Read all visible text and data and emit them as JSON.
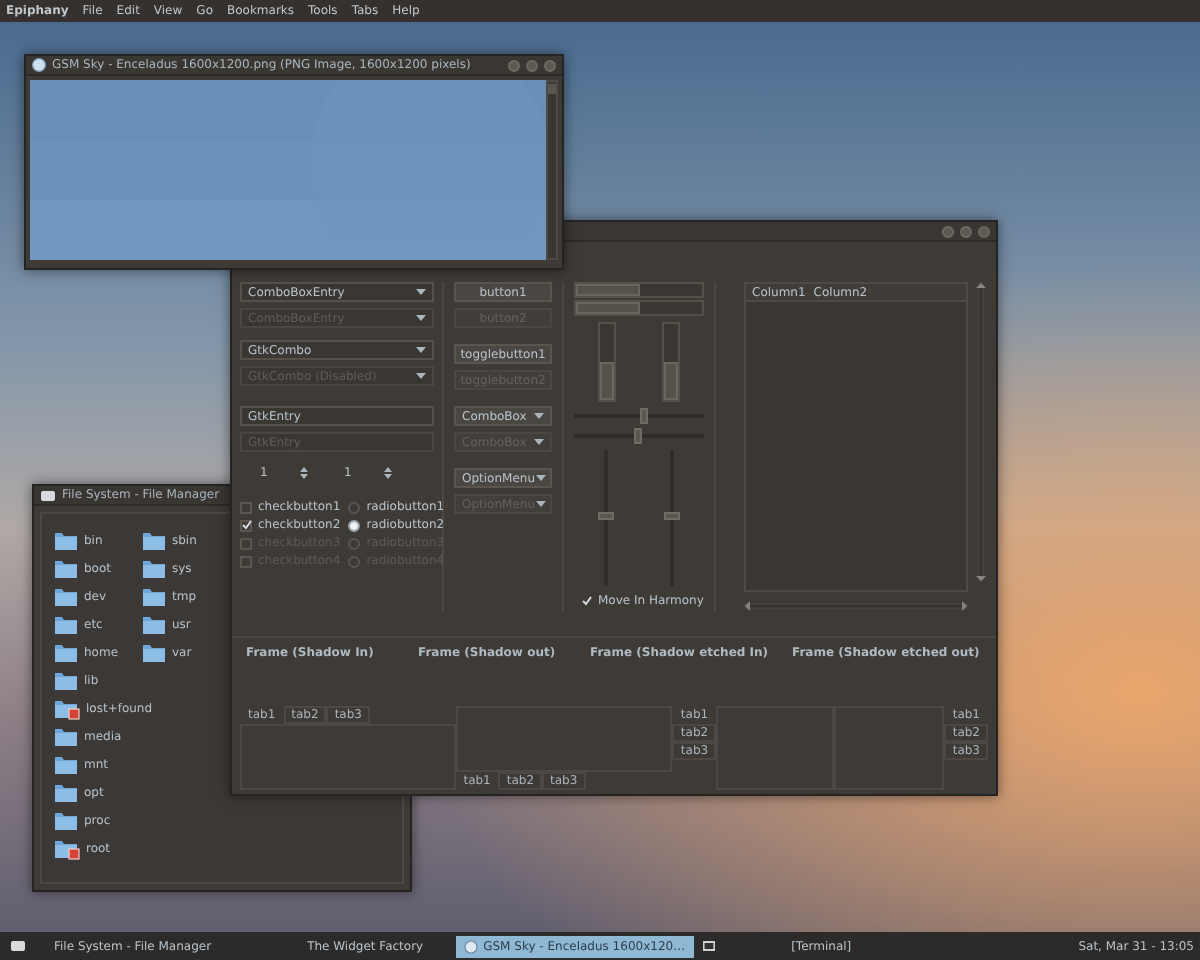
{
  "menubar": {
    "app": "Epiphany",
    "items": [
      "File",
      "Edit",
      "View",
      "Go",
      "Bookmarks",
      "Tools",
      "Tabs",
      "Help"
    ]
  },
  "browser_window": {
    "title": "GSM Sky - Enceladus 1600x1200.png (PNG Image, 1600x1200 pixels)"
  },
  "widget_factory": {
    "fields": [
      {
        "kind": "combo",
        "text": "ComboBoxEntry",
        "disabled": false
      },
      {
        "kind": "combo",
        "text": "ComboBoxEntry",
        "disabled": true
      },
      {
        "kind": "combo",
        "text": "GtkCombo",
        "disabled": false
      },
      {
        "kind": "combo",
        "text": "GtkCombo (Disabled)",
        "disabled": true
      },
      {
        "kind": "entry",
        "text": "GtkEntry",
        "disabled": false
      },
      {
        "kind": "entry",
        "text": "GtkEntry",
        "disabled": true
      }
    ],
    "spinbuttons": [
      "1",
      "1"
    ],
    "checkbuttons": [
      {
        "label": "checkbutton1",
        "checked": false,
        "disabled": false
      },
      {
        "label": "checkbutton2",
        "checked": true,
        "disabled": false
      },
      {
        "label": "checkbutton3",
        "checked": false,
        "disabled": true
      },
      {
        "label": "checkbutton4",
        "checked": false,
        "disabled": true
      }
    ],
    "radiobuttons": [
      {
        "label": "radiobutton1",
        "selected": false,
        "disabled": false
      },
      {
        "label": "radiobutton2",
        "selected": true,
        "disabled": false
      },
      {
        "label": "radiobutton3",
        "selected": false,
        "disabled": true
      },
      {
        "label": "radiobutton4",
        "selected": false,
        "disabled": true
      }
    ],
    "buttons": [
      {
        "kind": "button",
        "label": "button1",
        "disabled": false
      },
      {
        "kind": "button",
        "label": "button2",
        "disabled": true
      },
      {
        "kind": "button",
        "label": "togglebutton1",
        "disabled": false
      },
      {
        "kind": "button",
        "label": "togglebutton2",
        "disabled": true
      },
      {
        "kind": "combo",
        "label": "ComboBox",
        "disabled": false
      },
      {
        "kind": "combo",
        "label": "ComboBox",
        "disabled": true
      },
      {
        "kind": "combo",
        "label": "OptionMenu",
        "disabled": false
      },
      {
        "kind": "combo",
        "label": "OptionMenu",
        "disabled": true
      }
    ],
    "horizontal_progress_bars": [
      {
        "level": 0.5
      },
      {
        "level": 0.5
      }
    ],
    "vertical_progress_bars": [
      {
        "level": 0.5
      },
      {
        "level": 0.5
      }
    ],
    "horizontal_scales": [
      {
        "level": 0.55
      },
      {
        "level": 0.5
      }
    ],
    "vertical_scales": [
      {
        "level": 0.5
      },
      {
        "level": 0.5
      }
    ],
    "harmony": {
      "label": "Move In Harmony",
      "checked": true
    },
    "tree": {
      "columns": [
        "Column1",
        "Column2"
      ]
    },
    "frames": [
      "Frame (Shadow In)",
      "Frame (Shadow out)",
      "Frame (Shadow etched In)",
      "Frame (Shadow etched out)"
    ],
    "notebooks": [
      {
        "kind": "tabs-top",
        "tabs": [
          {
            "label": "tab1",
            "selected": true
          },
          {
            "label": "tab2",
            "selected": false
          },
          {
            "label": "tab3",
            "selected": false
          }
        ]
      },
      {
        "kind": "tabs-bottom",
        "tabs": [
          {
            "label": "tab1",
            "selected": true
          },
          {
            "label": "tab2",
            "selected": false
          },
          {
            "label": "tab3",
            "selected": false
          }
        ]
      },
      {
        "kind": "tabs-left",
        "tabs": [
          {
            "label": "tab1",
            "selected": true
          },
          {
            "label": "tab2",
            "selected": false
          },
          {
            "label": "tab3",
            "selected": false
          }
        ]
      },
      {
        "kind": "tabs-right",
        "tabs": [
          {
            "label": "tab1",
            "selected": true
          },
          {
            "label": "tab2",
            "selected": false
          },
          {
            "label": "tab3",
            "selected": false
          }
        ]
      }
    ]
  },
  "file_manager": {
    "title": "File System - File Manager",
    "folders": [
      {
        "name": "bin",
        "emblem": false
      },
      {
        "name": "boot",
        "emblem": false
      },
      {
        "name": "dev",
        "emblem": false
      },
      {
        "name": "etc",
        "emblem": false
      },
      {
        "name": "home",
        "emblem": false
      },
      {
        "name": "lib",
        "emblem": false
      },
      {
        "name": "lost+found",
        "emblem": true
      },
      {
        "name": "media",
        "emblem": false
      },
      {
        "name": "mnt",
        "emblem": false
      },
      {
        "name": "opt",
        "emblem": false
      },
      {
        "name": "proc",
        "emblem": false
      },
      {
        "name": "root",
        "emblem": true
      },
      {
        "name": "sbin",
        "emblem": false
      },
      {
        "name": "sys",
        "emblem": false
      },
      {
        "name": "tmp",
        "emblem": false
      },
      {
        "name": "usr",
        "emblem": false
      },
      {
        "name": "var",
        "emblem": false
      }
    ]
  },
  "taskbar": {
    "items": [
      {
        "label": "File System - File Manager",
        "selected": false
      },
      {
        "label": "The Widget Factory",
        "selected": false
      },
      {
        "label": "GSM Sky - Enceladus 1600x120…",
        "selected": true
      },
      {
        "label": "[Terminal]",
        "selected": false
      }
    ],
    "clock": "Sat, Mar 31 - 13:05"
  }
}
